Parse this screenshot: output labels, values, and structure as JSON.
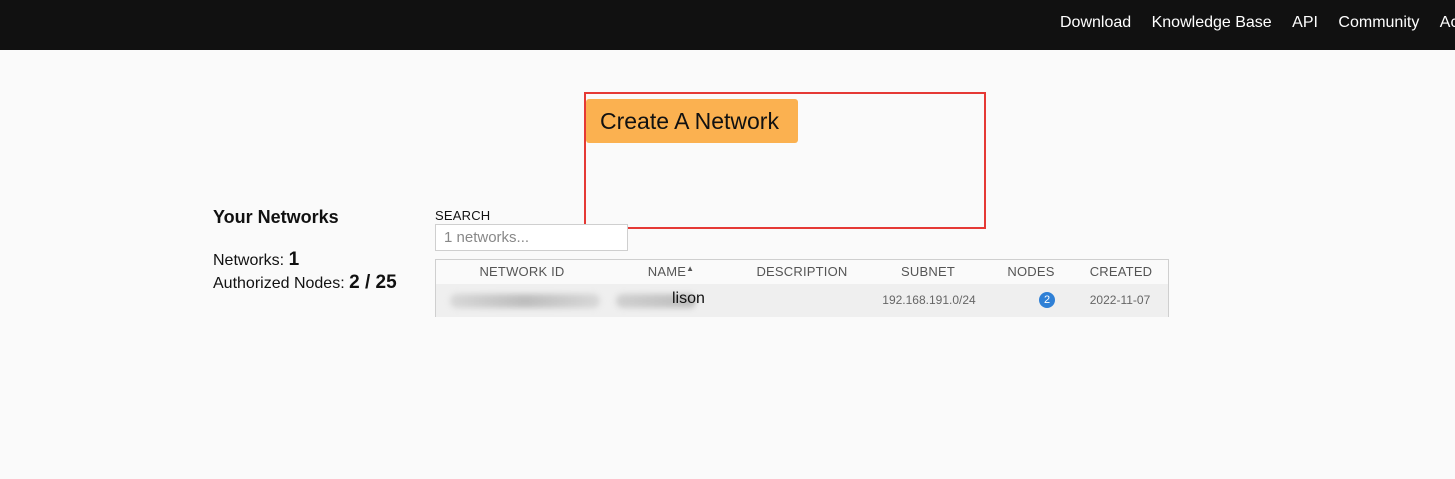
{
  "topnav": {
    "items": [
      "Download",
      "Knowledge Base",
      "API",
      "Community",
      "Account"
    ]
  },
  "actions": {
    "create_label": "Create A Network"
  },
  "summary": {
    "title": "Your Networks",
    "networks_label": "Networks:",
    "networks_value": "1",
    "nodes_label": "Authorized Nodes:",
    "nodes_value": "2 / 25"
  },
  "search": {
    "label": "SEARCH",
    "placeholder": "1 networks..."
  },
  "table": {
    "columns": [
      "NETWORK ID",
      "NAME",
      "DESCRIPTION",
      "SUBNET",
      "NODES",
      "CREATED"
    ],
    "rows": [
      {
        "name_visible": "lison",
        "description": "",
        "subnet": "192.168.191.0/24",
        "nodes": "2",
        "created": "2022-11-07"
      }
    ]
  },
  "colors": {
    "topbar": "#111111",
    "create_button": "#fbb150",
    "highlight": "#e53935",
    "nodes_badge": "#2f80d6"
  }
}
